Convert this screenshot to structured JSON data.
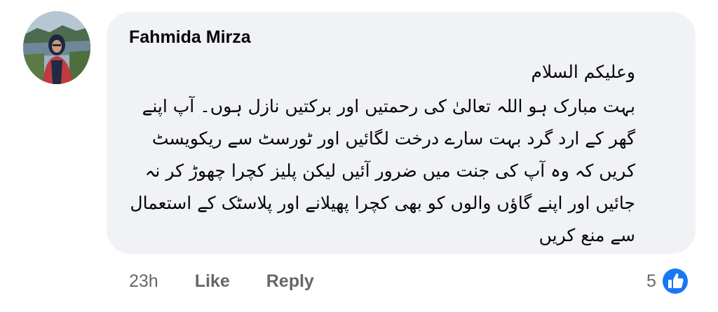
{
  "comment": {
    "author": "Fahmida Mirza",
    "greeting": "وعلیکم السلام",
    "message": "بہت مبارک ہو اللہ تعالیٰ کی رحمتیں اور برکتیں نازل ہوں۔ آپ اپنے گھر کے ارد گرد بہت سارے درخت لگائیں اور ٹورسٹ سے ریکویسٹ کریں کہ وہ آپ کی جنت میں ضرور آئیں لیکن پلیز کچرا چھوڑ کر نہ جائیں اور اپنے گاؤں والوں کو بھی کچرا پھیلانے اور پلاسٹک کے استعمال سے منع کریں",
    "timestamp": "23h",
    "like_label": "Like",
    "reply_label": "Reply",
    "reaction_count": "5",
    "reaction_icon": "like-thumbs-up-icon"
  },
  "colors": {
    "bubble_bg": "#f0f2f5",
    "meta_text": "#65676b",
    "like_blue": "#1877f2"
  }
}
